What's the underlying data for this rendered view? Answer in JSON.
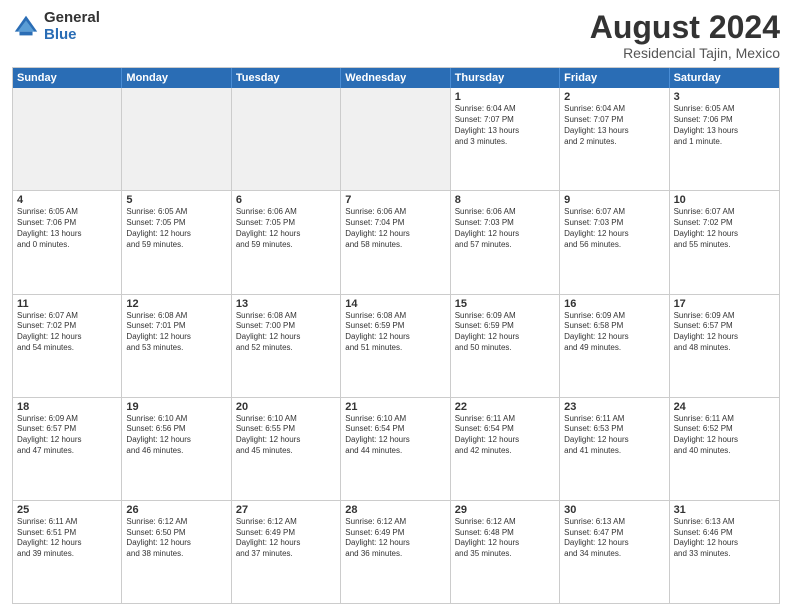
{
  "logo": {
    "general": "General",
    "blue": "Blue"
  },
  "title": "August 2024",
  "subtitle": "Residencial Tajin, Mexico",
  "header_days": [
    "Sunday",
    "Monday",
    "Tuesday",
    "Wednesday",
    "Thursday",
    "Friday",
    "Saturday"
  ],
  "weeks": [
    [
      {
        "day": "",
        "info": ""
      },
      {
        "day": "",
        "info": ""
      },
      {
        "day": "",
        "info": ""
      },
      {
        "day": "",
        "info": ""
      },
      {
        "day": "1",
        "info": "Sunrise: 6:04 AM\nSunset: 7:07 PM\nDaylight: 13 hours\nand 3 minutes."
      },
      {
        "day": "2",
        "info": "Sunrise: 6:04 AM\nSunset: 7:07 PM\nDaylight: 13 hours\nand 2 minutes."
      },
      {
        "day": "3",
        "info": "Sunrise: 6:05 AM\nSunset: 7:06 PM\nDaylight: 13 hours\nand 1 minute."
      }
    ],
    [
      {
        "day": "4",
        "info": "Sunrise: 6:05 AM\nSunset: 7:06 PM\nDaylight: 13 hours\nand 0 minutes."
      },
      {
        "day": "5",
        "info": "Sunrise: 6:05 AM\nSunset: 7:05 PM\nDaylight: 12 hours\nand 59 minutes."
      },
      {
        "day": "6",
        "info": "Sunrise: 6:06 AM\nSunset: 7:05 PM\nDaylight: 12 hours\nand 59 minutes."
      },
      {
        "day": "7",
        "info": "Sunrise: 6:06 AM\nSunset: 7:04 PM\nDaylight: 12 hours\nand 58 minutes."
      },
      {
        "day": "8",
        "info": "Sunrise: 6:06 AM\nSunset: 7:03 PM\nDaylight: 12 hours\nand 57 minutes."
      },
      {
        "day": "9",
        "info": "Sunrise: 6:07 AM\nSunset: 7:03 PM\nDaylight: 12 hours\nand 56 minutes."
      },
      {
        "day": "10",
        "info": "Sunrise: 6:07 AM\nSunset: 7:02 PM\nDaylight: 12 hours\nand 55 minutes."
      }
    ],
    [
      {
        "day": "11",
        "info": "Sunrise: 6:07 AM\nSunset: 7:02 PM\nDaylight: 12 hours\nand 54 minutes."
      },
      {
        "day": "12",
        "info": "Sunrise: 6:08 AM\nSunset: 7:01 PM\nDaylight: 12 hours\nand 53 minutes."
      },
      {
        "day": "13",
        "info": "Sunrise: 6:08 AM\nSunset: 7:00 PM\nDaylight: 12 hours\nand 52 minutes."
      },
      {
        "day": "14",
        "info": "Sunrise: 6:08 AM\nSunset: 6:59 PM\nDaylight: 12 hours\nand 51 minutes."
      },
      {
        "day": "15",
        "info": "Sunrise: 6:09 AM\nSunset: 6:59 PM\nDaylight: 12 hours\nand 50 minutes."
      },
      {
        "day": "16",
        "info": "Sunrise: 6:09 AM\nSunset: 6:58 PM\nDaylight: 12 hours\nand 49 minutes."
      },
      {
        "day": "17",
        "info": "Sunrise: 6:09 AM\nSunset: 6:57 PM\nDaylight: 12 hours\nand 48 minutes."
      }
    ],
    [
      {
        "day": "18",
        "info": "Sunrise: 6:09 AM\nSunset: 6:57 PM\nDaylight: 12 hours\nand 47 minutes."
      },
      {
        "day": "19",
        "info": "Sunrise: 6:10 AM\nSunset: 6:56 PM\nDaylight: 12 hours\nand 46 minutes."
      },
      {
        "day": "20",
        "info": "Sunrise: 6:10 AM\nSunset: 6:55 PM\nDaylight: 12 hours\nand 45 minutes."
      },
      {
        "day": "21",
        "info": "Sunrise: 6:10 AM\nSunset: 6:54 PM\nDaylight: 12 hours\nand 44 minutes."
      },
      {
        "day": "22",
        "info": "Sunrise: 6:11 AM\nSunset: 6:54 PM\nDaylight: 12 hours\nand 42 minutes."
      },
      {
        "day": "23",
        "info": "Sunrise: 6:11 AM\nSunset: 6:53 PM\nDaylight: 12 hours\nand 41 minutes."
      },
      {
        "day": "24",
        "info": "Sunrise: 6:11 AM\nSunset: 6:52 PM\nDaylight: 12 hours\nand 40 minutes."
      }
    ],
    [
      {
        "day": "25",
        "info": "Sunrise: 6:11 AM\nSunset: 6:51 PM\nDaylight: 12 hours\nand 39 minutes."
      },
      {
        "day": "26",
        "info": "Sunrise: 6:12 AM\nSunset: 6:50 PM\nDaylight: 12 hours\nand 38 minutes."
      },
      {
        "day": "27",
        "info": "Sunrise: 6:12 AM\nSunset: 6:49 PM\nDaylight: 12 hours\nand 37 minutes."
      },
      {
        "day": "28",
        "info": "Sunrise: 6:12 AM\nSunset: 6:49 PM\nDaylight: 12 hours\nand 36 minutes."
      },
      {
        "day": "29",
        "info": "Sunrise: 6:12 AM\nSunset: 6:48 PM\nDaylight: 12 hours\nand 35 minutes."
      },
      {
        "day": "30",
        "info": "Sunrise: 6:13 AM\nSunset: 6:47 PM\nDaylight: 12 hours\nand 34 minutes."
      },
      {
        "day": "31",
        "info": "Sunrise: 6:13 AM\nSunset: 6:46 PM\nDaylight: 12 hours\nand 33 minutes."
      }
    ]
  ]
}
